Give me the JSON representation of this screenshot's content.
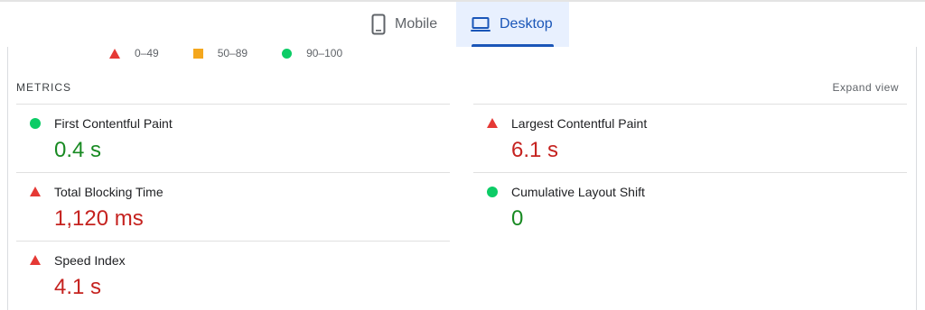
{
  "tabs": {
    "mobile_label": "Mobile",
    "desktop_label": "Desktop",
    "active": "Desktop"
  },
  "legend": [
    {
      "range": "0–49",
      "shape": "triangle",
      "color": "#e53935"
    },
    {
      "range": "50–89",
      "shape": "square",
      "color": "#f4a71d"
    },
    {
      "range": "90–100",
      "shape": "circle",
      "color": "#0ccc66"
    }
  ],
  "metrics": {
    "title": "METRICS",
    "expand_label": "Expand view",
    "items": [
      {
        "label": "First Contentful Paint",
        "value": "0.4 s",
        "status": "good",
        "icon": "circle-icon"
      },
      {
        "label": "Largest Contentful Paint",
        "value": "6.1 s",
        "status": "poor",
        "icon": "triangle-icon"
      },
      {
        "label": "Total Blocking Time",
        "value": "1,120 ms",
        "status": "poor",
        "icon": "triangle-icon"
      },
      {
        "label": "Cumulative Layout Shift",
        "value": "0",
        "status": "good",
        "icon": "circle-icon"
      },
      {
        "label": "Speed Index",
        "value": "4.1 s",
        "status": "poor",
        "icon": "triangle-icon"
      }
    ]
  },
  "colors": {
    "good": "#188a22",
    "poor": "#c5221f",
    "accent": "#1a56b8",
    "tab_active_bg": "#e8f0fe"
  }
}
